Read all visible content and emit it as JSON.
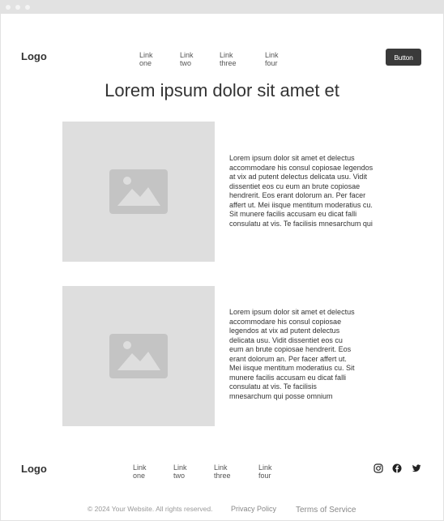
{
  "header": {
    "logo": "Logo",
    "nav": [
      "Link one",
      "Link two",
      "Link three",
      "Link four"
    ],
    "button": "Button"
  },
  "hero": {
    "title": "Lorem ipsum dolor sit amet et"
  },
  "sections": [
    {
      "image_icon": "image-placeholder-icon",
      "lines": [
        "Lorem ipsum dolor sit amet et delectus",
        "accommodare his consul copiosae legendos",
        "at vix ad putent delectus delicata usu. Vidit",
        "dissentiet eos cu eum an brute copiosae",
        "hendrerit. Eos erant dolorum an. Per facer",
        "affert ut. Mei iisque mentitum moderatius cu.",
        "Sit munere facilis accusam eu dicat falli",
        "consulatu at vis. Te facilisis mnesarchum qui"
      ]
    },
    {
      "image_icon": "image-placeholder-icon",
      "lines": [
        "Lorem ipsum dolor sit amet et delectus",
        "accommodare his consul copiosae",
        "legendos at vix ad putent delectus",
        "delicata usu. Vidit dissentiet eos cu",
        "eum an brute copiosae hendrerit. Eos",
        "erant dolorum an. Per facer affert ut.",
        "Mei iisque mentitum moderatius cu. Sit",
        "munere facilis accusam eu dicat falli",
        "consulatu at vis. Te facilisis",
        "mnesarchum qui posse omnium"
      ]
    }
  ],
  "footer": {
    "logo": "Logo",
    "nav": [
      "Link one",
      "Link two",
      "Link three",
      "Link four"
    ],
    "social_icons": [
      "instagram-icon",
      "facebook-icon",
      "twitter-icon"
    ],
    "copyright": "© 2024 Your Website. All rights reserved.",
    "privacy": "Privacy Policy",
    "terms": "Terms of Service"
  },
  "colors": {
    "button_bg": "#3a3a3a",
    "placeholder_bg": "#dedede",
    "placeholder_icon": "#c4c4c4",
    "titlebar": "#e2e2e2"
  }
}
